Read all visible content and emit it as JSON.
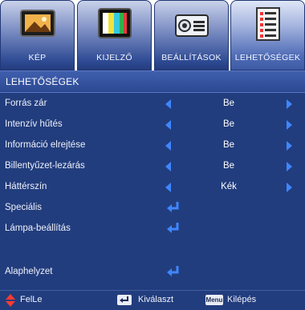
{
  "tabs": [
    {
      "label": "KÉP",
      "icon": "picture-icon"
    },
    {
      "label": "KIJELZŐ",
      "icon": "display-icon"
    },
    {
      "label": "BEÁLLÍTÁSOK",
      "icon": "projector-icon"
    },
    {
      "label": "LEHETŐSÉGEK",
      "icon": "options-icon"
    }
  ],
  "panel": {
    "title": "LEHETŐSÉGEK",
    "rows": [
      {
        "label": "Forrás zár",
        "value": "Be"
      },
      {
        "label": "Intenzív hűtés",
        "value": "Be"
      },
      {
        "label": "Információ elrejtése",
        "value": "Be"
      },
      {
        "label": "Billentyűzet-lezárás",
        "value": "Be"
      },
      {
        "label": "Háttérszín",
        "value": "Kék"
      },
      {
        "label": "Speciális",
        "icon": "enter-icon"
      },
      {
        "label": "Lámpa-beállítás",
        "icon": "enter-icon"
      },
      {
        "label": "Alaphelyzet",
        "icon": "enter-icon"
      }
    ]
  },
  "footer": {
    "navigate_label": "FelLe",
    "select_label": "Kiválaszt",
    "menu_key": "Menu",
    "exit_label": "Kilépés"
  },
  "colors": {
    "panel_bg": "#223d7d",
    "arrow": "#3f86ff",
    "navigate_icon": "#ff3b30"
  }
}
